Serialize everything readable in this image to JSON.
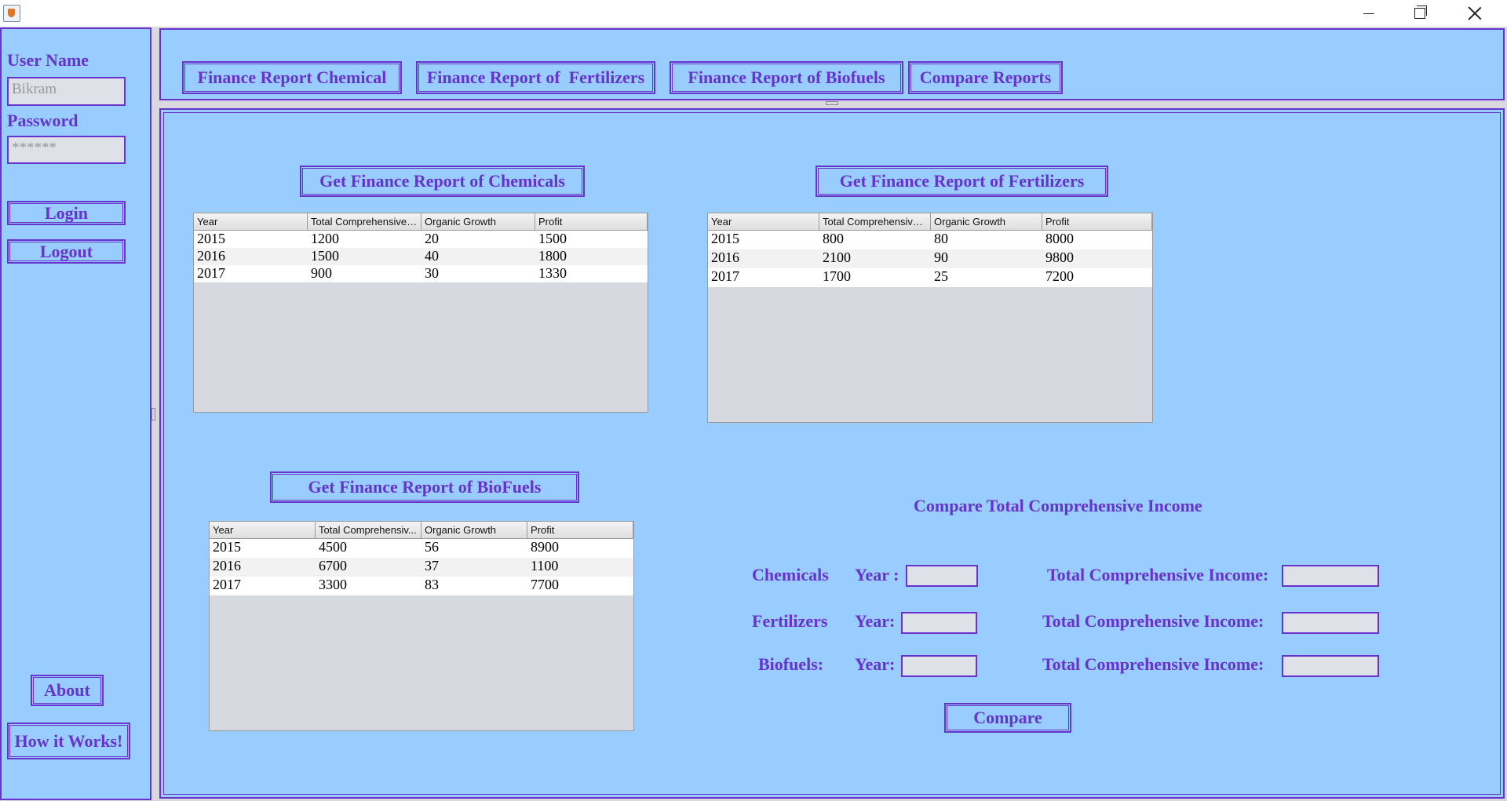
{
  "sidebar": {
    "username_label": "User Name",
    "username_value": "Bikram",
    "password_label": "Password",
    "password_value": "******",
    "login": "Login",
    "logout": "Logout",
    "about": "About",
    "how_it_works": "How it Works!"
  },
  "topbar": {
    "tabs": [
      {
        "label": "Finance Report Chemical"
      },
      {
        "label": "Finance Report of  Fertilizers"
      },
      {
        "label": "Finance Report of Biofuels"
      },
      {
        "label": "Compare Reports"
      }
    ]
  },
  "chemicals": {
    "button": "Get Finance Report of Chemicals",
    "headers": [
      "Year",
      "Total Comprehensive I...",
      "Organic Growth",
      "Profit"
    ],
    "rows": [
      [
        "2015",
        "1200",
        "20",
        "1500"
      ],
      [
        "2016",
        "1500",
        "40",
        "1800"
      ],
      [
        "2017",
        "900",
        "30",
        "1330"
      ]
    ]
  },
  "fertilizers": {
    "button": "Get Finance Report of Fertilizers",
    "headers": [
      "Year",
      "Total Comprehensive ...",
      "Organic Growth",
      "Profit"
    ],
    "rows": [
      [
        "2015",
        "800",
        "80",
        "8000"
      ],
      [
        "2016",
        "2100",
        "90",
        "9800"
      ],
      [
        "2017",
        "1700",
        "25",
        "7200"
      ]
    ]
  },
  "biofuels": {
    "button": "Get Finance Report of BioFuels",
    "headers": [
      "Year",
      "Total Comprehensiv...",
      "Organic Growth",
      "Profit"
    ],
    "rows": [
      [
        "2015",
        "4500",
        "56",
        "8900"
      ],
      [
        "2016",
        "6700",
        "37",
        "1100"
      ],
      [
        "2017",
        "3300",
        "83",
        "7700"
      ]
    ]
  },
  "compare": {
    "title": "Compare Total Comprehensive Income",
    "rows": [
      {
        "category": "Chemicals",
        "year_label": "Year :",
        "income_label": "Total Comprehensive Income:"
      },
      {
        "category": "Fertilizers",
        "year_label": "Year:",
        "income_label": "Total Comprehensive Income:"
      },
      {
        "category": "Biofuels:",
        "year_label": "Year:",
        "income_label": "Total Comprehensive Income:"
      }
    ],
    "button": "Compare"
  },
  "colors": {
    "panel_bg": "#99ccff",
    "accent": "#6633cc",
    "field_bg": "#dfe1e8"
  }
}
